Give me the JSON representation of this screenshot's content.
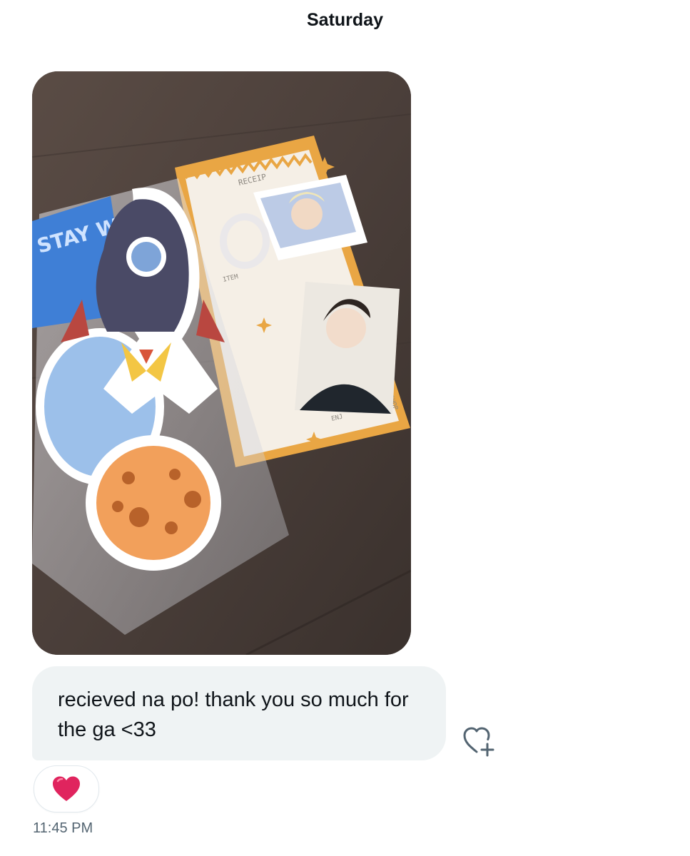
{
  "conversation": {
    "date_separator": "Saturday",
    "message": {
      "media": {
        "kind": "photo",
        "printed_text": [
          "RECEIP",
          "ITEM",
          "ENJ",
          "SHOP",
          "STAY WEEK"
        ]
      },
      "text": "recieved na po! thank you so much for the ga <33",
      "reaction": {
        "emoji": "❤️",
        "icon": "red-heart-icon"
      },
      "add_reaction_icon": "heart-plus-icon",
      "timestamp": "11:45 PM"
    }
  },
  "colors": {
    "bubble_background": "#eff3f4",
    "text_primary": "#0f1419",
    "text_secondary": "#536471",
    "reaction_heart": "#e0245e"
  }
}
